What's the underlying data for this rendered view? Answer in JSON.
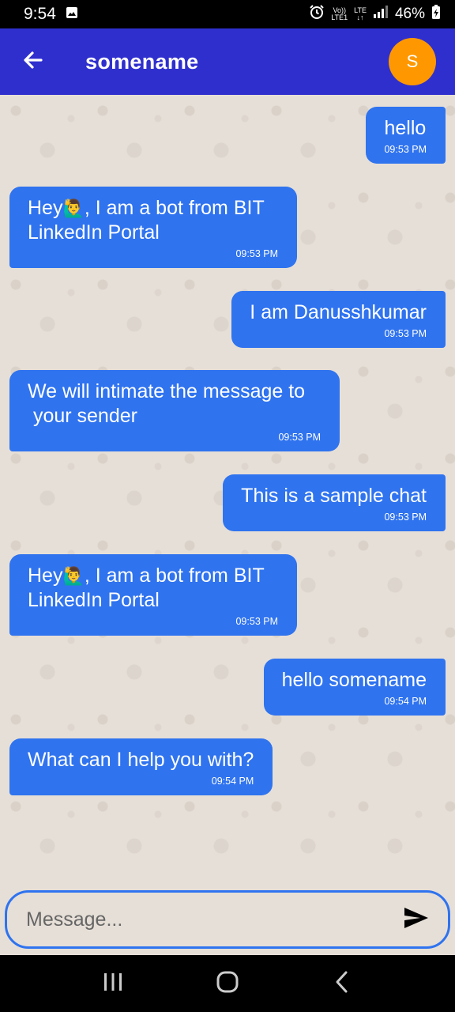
{
  "status_bar": {
    "time": "9:54",
    "volte_top": "Vo))",
    "volte_bottom": "LTE1",
    "network_top": "LTE",
    "network_bottom": "↓↑",
    "battery": "46%"
  },
  "header": {
    "title": "somename",
    "avatar_initial": "S"
  },
  "messages": [
    {
      "side": "sent",
      "text": "hello",
      "time": "09:53 PM"
    },
    {
      "side": "recv",
      "text_before": "Hey",
      "emoji": "🙋‍♂️",
      "text_after": ", I am a bot from BIT\nLinkedIn Portal",
      "time": "09:53 PM"
    },
    {
      "side": "sent",
      "text": "I am Danusshkumar",
      "time": "09:53 PM"
    },
    {
      "side": "recv",
      "text": "We will intimate the message to\n your sender",
      "time": "09:53 PM"
    },
    {
      "side": "sent",
      "text": "This is a sample chat",
      "time": "09:53 PM"
    },
    {
      "side": "recv",
      "text_before": "Hey",
      "emoji": "🙋‍♂️",
      "text_after": ", I am a bot from BIT\nLinkedIn Portal",
      "time": "09:53 PM"
    },
    {
      "side": "sent",
      "text": "hello somename",
      "time": "09:54 PM"
    },
    {
      "side": "recv",
      "text": "What can I help you with?",
      "time": "09:54 PM"
    }
  ],
  "composer": {
    "placeholder": "Message..."
  },
  "icons": {
    "back": "arrow-left",
    "send": "send",
    "recents": "recents",
    "home": "home",
    "nav_back": "chevron-left"
  },
  "colors": {
    "app_bar": "#2f2fce",
    "bubble": "#2f73ef",
    "avatar": "#ff9800",
    "background": "#e6dfd7"
  }
}
